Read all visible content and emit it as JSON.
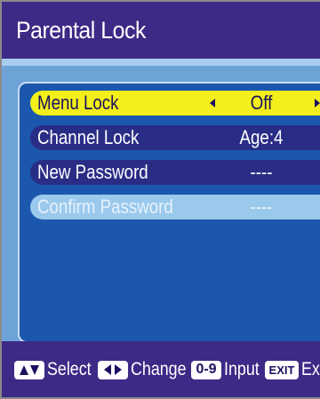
{
  "screen": {
    "title": "Parental Lock"
  },
  "menu": {
    "items": [
      {
        "label": "Menu Lock",
        "value": "Off",
        "state": "selected"
      },
      {
        "label": "Channel Lock",
        "value": "Age:4",
        "state": "normal"
      },
      {
        "label": "New Password",
        "value": "----",
        "state": "normal"
      },
      {
        "label": "Confirm Password",
        "value": "----",
        "state": "disabled"
      }
    ]
  },
  "footer": {
    "select_icon": "up-down-arrows-icon",
    "select_label": "Select",
    "change_icon": "left-right-arrows-icon",
    "change_label": "Change",
    "input_key": "0-9",
    "input_label": "Input",
    "exit_key": "EXIT",
    "exit_label": "Exi"
  },
  "colors": {
    "background": "#3d2a86",
    "panel": "#6ea3d8",
    "menu_box": "#1b57ad",
    "selected_row": "#f3ef1a",
    "normal_row": "#2a2d86",
    "disabled_row": "#9ac9ec"
  }
}
